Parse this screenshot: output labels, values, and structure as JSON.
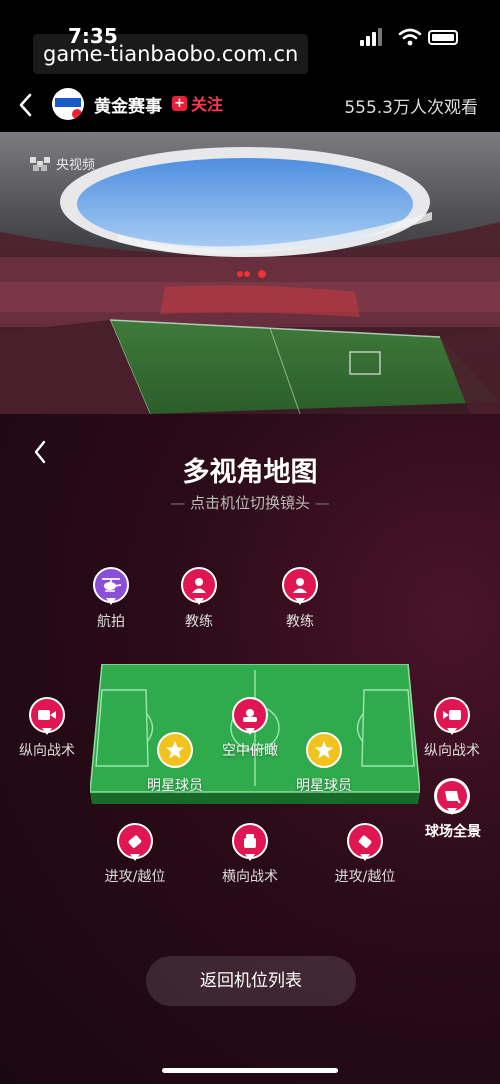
{
  "status_bar": {
    "time": "7:35",
    "watermark": "game-tianbaobo.com.cn"
  },
  "header": {
    "channel_name": "黄金赛事",
    "follow_label": "关注",
    "views": "555.3万人次观看"
  },
  "video": {
    "source_label": "央视频"
  },
  "panel": {
    "title": "多视角地图",
    "subtitle": "点击机位切换镜头",
    "cameras": {
      "aerial": "航拍",
      "coach_left": "教练",
      "coach_right": "教练",
      "vertical_left": "纵向战术",
      "vertical_right": "纵向战术",
      "sky_view": "空中俯瞰",
      "star_left": "明星球员",
      "star_right": "明星球员",
      "panorama": "球场全景",
      "attack_left": "进攻/越位",
      "horizontal": "横向战术",
      "attack_right": "进攻/越位"
    },
    "return_button": "返回机位列表"
  },
  "colors": {
    "accent_red": "#e01652",
    "aerial_purple": "#8a4ed8",
    "star_gold": "#f2c21f",
    "pitch_green": "#2faa4c"
  }
}
